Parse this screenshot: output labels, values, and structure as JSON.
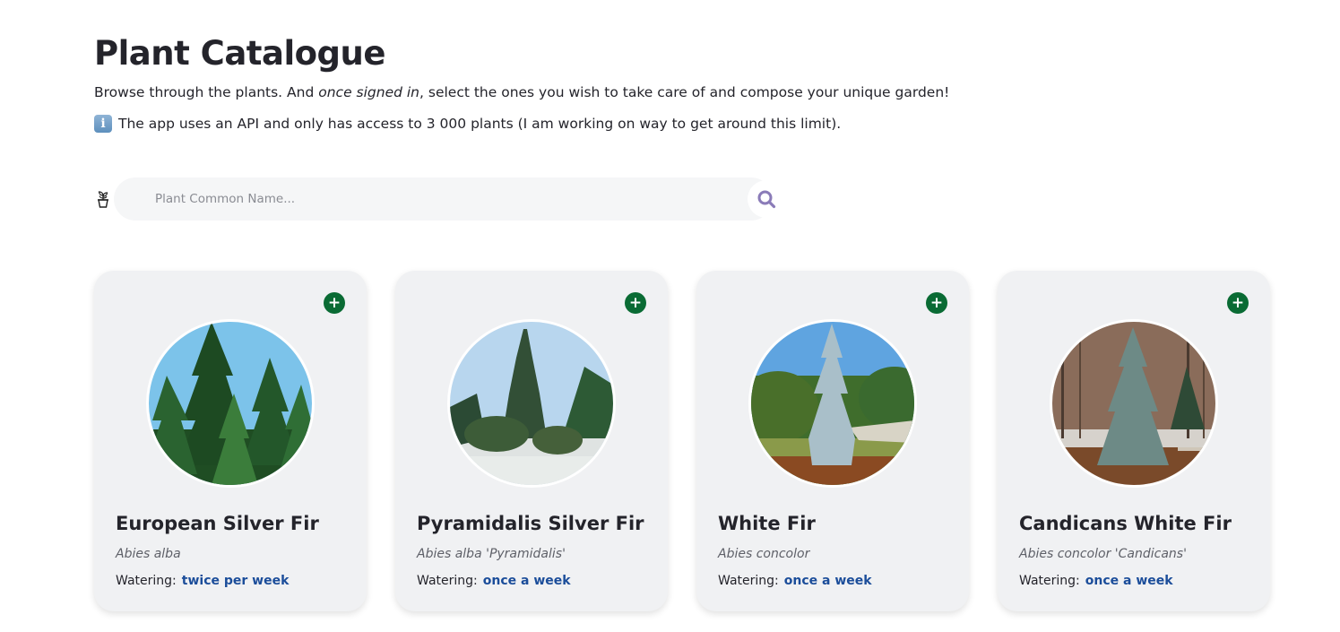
{
  "page": {
    "title": "Plant Catalogue",
    "intro_before": "Browse through the plants. And ",
    "intro_emphasis": "once signed in",
    "intro_after": ", select the ones you wish to take care of and compose your unique garden!",
    "note_icon": "information-icon",
    "note_icon_glyph": "i",
    "note": "The app uses an API and only has access to 3 000 plants (I am working on way to get around this limit)."
  },
  "search": {
    "leading_icon": "potted-plant-icon",
    "placeholder": "Plant Common Name...",
    "value": "",
    "button_icon": "search-icon"
  },
  "cards": [
    {
      "add_symbol": "+",
      "common_name": "European Silver Fir",
      "scientific_name": "Abies alba",
      "watering_label": "Watering:",
      "watering_value": "twice per week"
    },
    {
      "add_symbol": "+",
      "common_name": "Pyramidalis Silver Fir",
      "scientific_name": "Abies alba 'Pyramidalis'",
      "watering_label": "Watering:",
      "watering_value": "once a week"
    },
    {
      "add_symbol": "+",
      "common_name": "White Fir",
      "scientific_name": "Abies concolor",
      "watering_label": "Watering:",
      "watering_value": "once a week"
    },
    {
      "add_symbol": "+",
      "common_name": "Candicans White Fir",
      "scientific_name": "Abies concolor 'Candicans'",
      "watering_label": "Watering:",
      "watering_value": "once a week"
    }
  ],
  "colors": {
    "add_button": "#0a6b34",
    "watering_value": "#1b4d9a",
    "search_icon": "#8a7bb8",
    "card_background": "#f0f1f3"
  }
}
